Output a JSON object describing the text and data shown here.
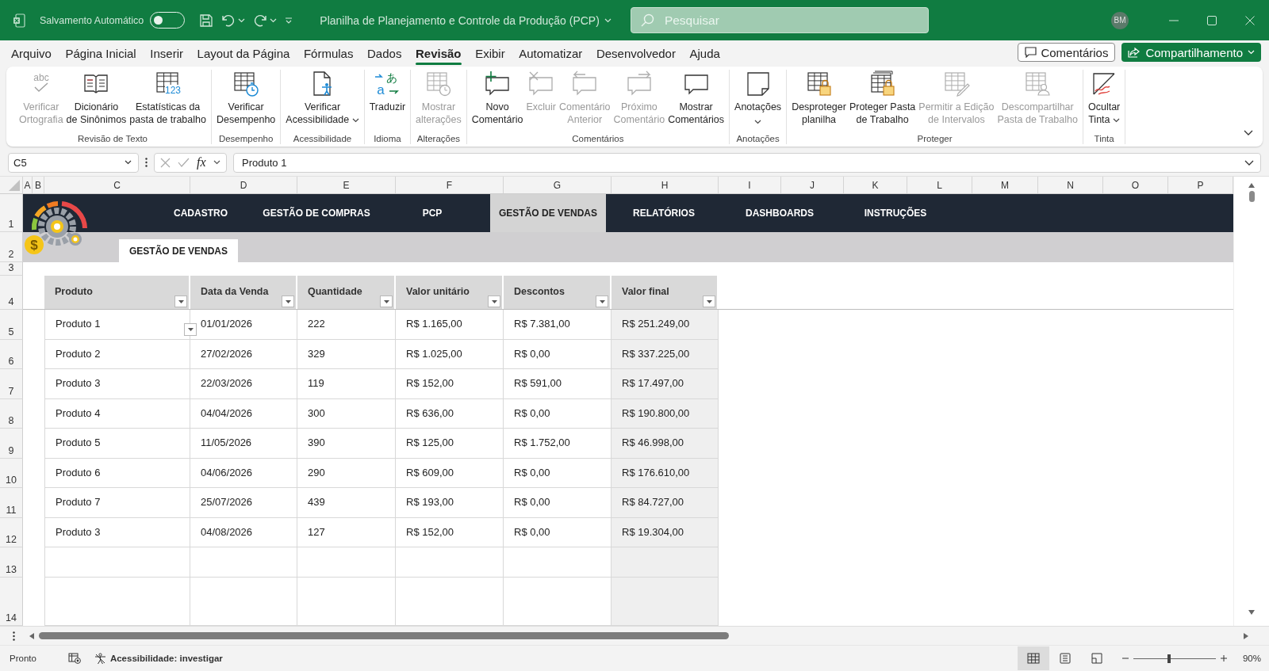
{
  "title_bar": {
    "autosave": {
      "label": "Salvamento Automático",
      "on": false
    },
    "document_title": "Planilha de Planejamento e Controle da Produção (PCP)",
    "search_placeholder": "Pesquisar",
    "user_initials": "BM"
  },
  "menu_tabs": [
    {
      "label": "Arquivo",
      "selected": false
    },
    {
      "label": "Página Inicial",
      "selected": false
    },
    {
      "label": "Inserir",
      "selected": false
    },
    {
      "label": "Layout da Página",
      "selected": false
    },
    {
      "label": "Fórmulas",
      "selected": false
    },
    {
      "label": "Dados",
      "selected": false
    },
    {
      "label": "Revisão",
      "selected": true
    },
    {
      "label": "Exibir",
      "selected": false
    },
    {
      "label": "Automatizar",
      "selected": false
    },
    {
      "label": "Desenvolvedor",
      "selected": false
    },
    {
      "label": "Ajuda",
      "selected": false
    }
  ],
  "header_buttons": {
    "comments": "Comentários",
    "share": "Compartilhamento"
  },
  "ribbon_groups": [
    {
      "label": "Revisão de Texto",
      "commands": [
        {
          "label": "Verificar\nOrtografia",
          "kind": "spell",
          "icon_text": [
            "abc"
          ],
          "disabled": true
        },
        {
          "label": "Dicionário\nde Sinônimos",
          "kind": "book",
          "disabled": false
        },
        {
          "label": "Estatísticas da\npasta de trabalho",
          "kind": "stats",
          "icon_text": [
            "123"
          ],
          "disabled": false
        }
      ]
    },
    {
      "label": "Desempenho",
      "commands": [
        {
          "label": "Verificar\nDesempenho",
          "kind": "performance",
          "disabled": false
        }
      ]
    },
    {
      "label": "Acessibilidade",
      "commands": [
        {
          "label": "Verificar\nAcessibilidade",
          "kind": "accessibility",
          "disabled": false,
          "dropdown": true
        }
      ]
    },
    {
      "label": "Idioma",
      "commands": [
        {
          "label": "Traduzir",
          "kind": "translate",
          "icon_text": [
            "あ",
            "a"
          ],
          "disabled": false
        }
      ]
    },
    {
      "label": "Alterações",
      "commands": [
        {
          "label": "Mostrar\nalterações",
          "kind": "changes",
          "disabled": true
        }
      ]
    },
    {
      "label": "Comentários",
      "commands": [
        {
          "label": "Novo\nComentário",
          "kind": "newcomment",
          "disabled": false
        },
        {
          "label": "Excluir",
          "kind": "delete",
          "disabled": true
        },
        {
          "label": "Comentário\nAnterior",
          "kind": "previous",
          "disabled": true
        },
        {
          "label": "Próximo\nComentário",
          "kind": "next",
          "disabled": true
        },
        {
          "label": "Mostrar\nComentários",
          "kind": "showcomments",
          "disabled": false
        }
      ]
    },
    {
      "label": "Anotações",
      "commands": [
        {
          "label": "Anotações",
          "kind": "notes",
          "disabled": false,
          "dropdown": true
        }
      ]
    },
    {
      "label": "Proteger",
      "commands": [
        {
          "label": "Desproteger\nplanilha",
          "kind": "sheetlock",
          "disabled": false
        },
        {
          "label": "Proteger Pasta\nde Trabalho",
          "kind": "booklock",
          "disabled": false
        },
        {
          "label": "Permitir a Edição\nde Intervalos",
          "kind": "allowedit",
          "disabled": true
        },
        {
          "label": "Descompartilhar\nPasta de Trabalho",
          "kind": "unshare",
          "disabled": true
        }
      ]
    },
    {
      "label": "Tinta",
      "commands": [
        {
          "label": "Ocultar\nTinta",
          "kind": "ink",
          "disabled": false,
          "dropdown": true
        }
      ]
    }
  ],
  "formula_bar": {
    "name_box": "C5",
    "function_label": "fx",
    "formula": "Produto 1"
  },
  "column_headers": [
    "A",
    "B",
    "C",
    "D",
    "E",
    "F",
    "G",
    "H",
    "I",
    "J",
    "K",
    "L",
    "M",
    "N",
    "O",
    "P"
  ],
  "row_numbers": [
    "1",
    "2",
    "3",
    "4",
    "5",
    "6",
    "7",
    "8",
    "9",
    "10",
    "11",
    "12",
    "13",
    "14"
  ],
  "logo_symbol": "$",
  "nav_tabs": [
    {
      "label": "CADASTRO",
      "selected": false
    },
    {
      "label": "GESTÃO DE COMPRAS",
      "selected": false
    },
    {
      "label": "PCP",
      "selected": false
    },
    {
      "label": "GESTÃO DE VENDAS",
      "selected": true
    },
    {
      "label": "RELATÓRIOS",
      "selected": false
    },
    {
      "label": "DASHBOARDS",
      "selected": false
    },
    {
      "label": "INSTRUÇÕES",
      "selected": false
    }
  ],
  "page_tab": "GESTÃO DE VENDAS",
  "table": {
    "columns": [
      "Produto",
      "Data da Venda",
      "Quantidade",
      "Valor unitário",
      "Descontos",
      "Valor final"
    ],
    "rows": [
      [
        "Produto 1",
        "01/01/2026",
        "222",
        "R$ 1.165,00",
        "R$ 7.381,00",
        "R$ 251.249,00"
      ],
      [
        "Produto 2",
        "27/02/2026",
        "329",
        "R$ 1.025,00",
        "R$ 0,00",
        "R$ 337.225,00"
      ],
      [
        "Produto 3",
        "22/03/2026",
        "119",
        "R$ 152,00",
        "R$ 591,00",
        "R$ 17.497,00"
      ],
      [
        "Produto 4",
        "04/04/2026",
        "300",
        "R$ 636,00",
        "R$ 0,00",
        "R$ 190.800,00"
      ],
      [
        "Produto 5",
        "11/05/2026",
        "390",
        "R$ 125,00",
        "R$ 1.752,00",
        "R$ 46.998,00"
      ],
      [
        "Produto 6",
        "04/06/2026",
        "290",
        "R$ 609,00",
        "R$ 0,00",
        "R$ 176.610,00"
      ],
      [
        "Produto 7",
        "25/07/2026",
        "439",
        "R$ 193,00",
        "R$ 0,00",
        "R$ 84.727,00"
      ],
      [
        "Produto 3",
        "04/08/2026",
        "127",
        "R$ 152,00",
        "R$ 0,00",
        "R$ 19.304,00"
      ]
    ]
  },
  "status_bar": {
    "ready": "Pronto",
    "accessibility": "Acessibilidade: investigar",
    "views": [
      {
        "kind": "normal",
        "selected": true
      },
      {
        "kind": "page-layout",
        "selected": false
      },
      {
        "kind": "page-break",
        "selected": false
      }
    ],
    "zoom": {
      "level": 0.43,
      "reading": "90%"
    }
  }
}
